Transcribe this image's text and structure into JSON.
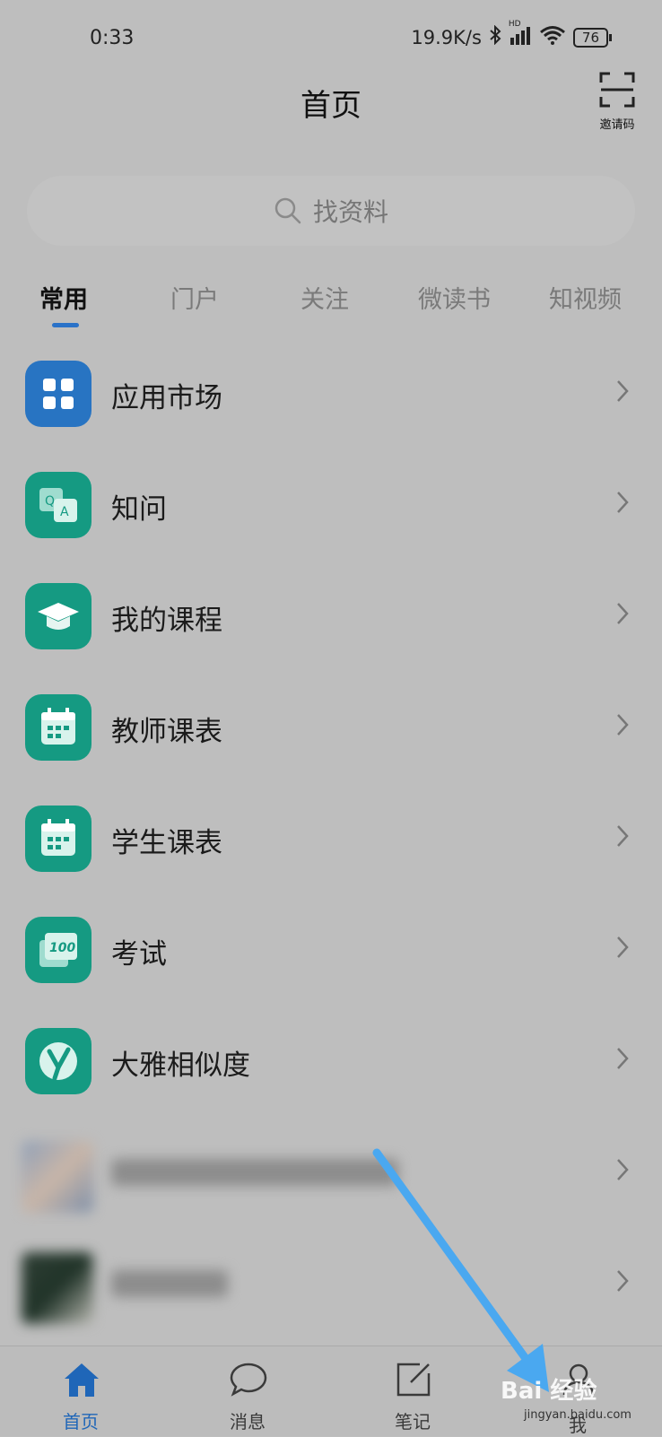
{
  "status_bar": {
    "time": "0:33",
    "speed": "19.9K/s",
    "signal_label": "HD",
    "battery": "76"
  },
  "header": {
    "title": "首页",
    "scan_label": "邀请码"
  },
  "search": {
    "placeholder": "找资料"
  },
  "tabs": [
    {
      "label": "常用",
      "active": true
    },
    {
      "label": "门户"
    },
    {
      "label": "关注"
    },
    {
      "label": "微读书"
    },
    {
      "label": "知视频"
    }
  ],
  "list": [
    {
      "label": "应用市场",
      "icon": "app-market-icon",
      "color": "#2874c2"
    },
    {
      "label": "知问",
      "icon": "qa-icon",
      "color": "#159a82"
    },
    {
      "label": "我的课程",
      "icon": "graduation-cap-icon",
      "color": "#159a82"
    },
    {
      "label": "教师课表",
      "icon": "calendar-icon",
      "color": "#159a82"
    },
    {
      "label": "学生课表",
      "icon": "calendar-icon",
      "color": "#159a82"
    },
    {
      "label": "考试",
      "icon": "exam-100-icon",
      "color": "#159a82"
    },
    {
      "label": "大雅相似度",
      "icon": "daya-icon",
      "color": "#159a82"
    }
  ],
  "bottom_nav": [
    {
      "label": "首页",
      "icon": "home-icon",
      "active": true
    },
    {
      "label": "消息",
      "icon": "message-icon"
    },
    {
      "label": "笔记",
      "icon": "note-icon"
    },
    {
      "label": "我",
      "icon": "profile-icon"
    }
  ],
  "colors": {
    "accent": "#1f66b8",
    "icon_teal": "#159a82",
    "arrow": "#4aa8f0"
  },
  "watermark": {
    "brand": "Bai 经验",
    "url": "jingyan.baidu.com"
  }
}
